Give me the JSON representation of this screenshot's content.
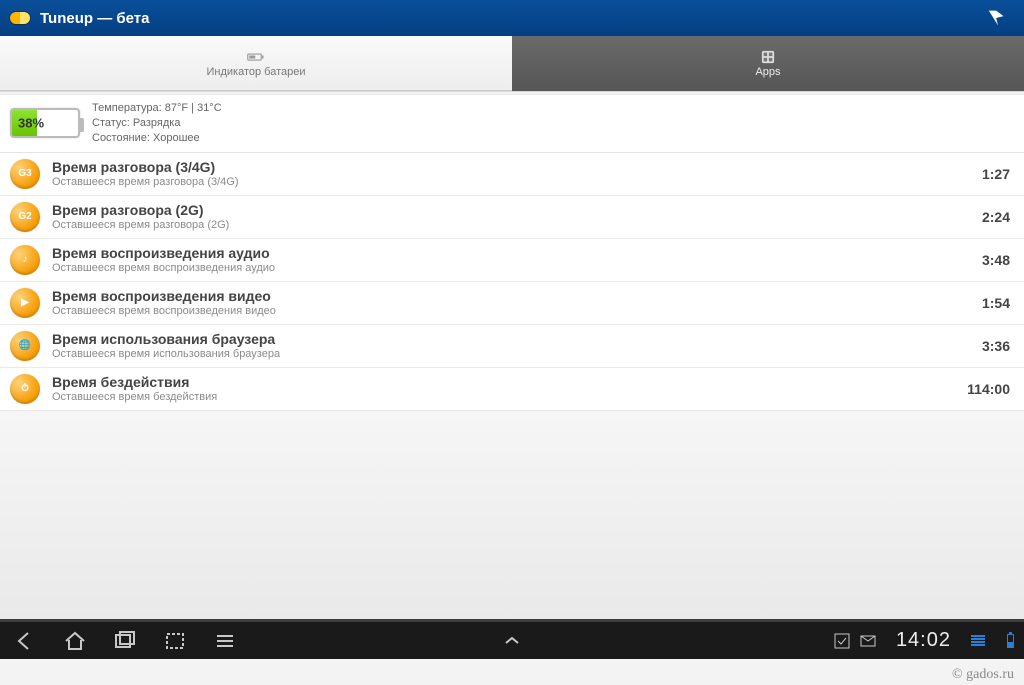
{
  "header": {
    "title": "Tuneup — бета"
  },
  "tabs": {
    "battery": {
      "label": "Индикатор батареи"
    },
    "apps": {
      "label": "Apps"
    }
  },
  "battery": {
    "percent_text": "38%",
    "fill_pct": 38,
    "temperature_label": "Температура:",
    "temperature_value": "87°F | 31°C",
    "status_label": "Статус:",
    "status_value": "Разрядка",
    "health_label": "Состояние:",
    "health_value": "Хорошее"
  },
  "items": [
    {
      "icon_text": "G3",
      "title": "Время разговора (3/4G)",
      "sub": "Оставшееся время разговора (3/4G)",
      "value": "1:27"
    },
    {
      "icon_text": "G2",
      "title": "Время разговора (2G)",
      "sub": "Оставшееся время разговора (2G)",
      "value": "2:24"
    },
    {
      "icon_text": "♪",
      "title": "Время воспроизведения аудио",
      "sub": "Оставшееся время воспроизведения аудио",
      "value": "3:48"
    },
    {
      "icon_text": "▶",
      "title": "Время воспроизведения видео",
      "sub": "Оставшееся время воспроизведения видео",
      "value": "1:54"
    },
    {
      "icon_text": "🌐",
      "title": "Время использования браузера",
      "sub": "Оставшееся время использования браузера",
      "value": "3:36"
    },
    {
      "icon_text": "⏱",
      "title": "Время бездействия",
      "sub": "Оставшееся время бездействия",
      "value": "114:00"
    }
  ],
  "statusbar": {
    "time": "14:02"
  },
  "watermark": "© gados.ru"
}
